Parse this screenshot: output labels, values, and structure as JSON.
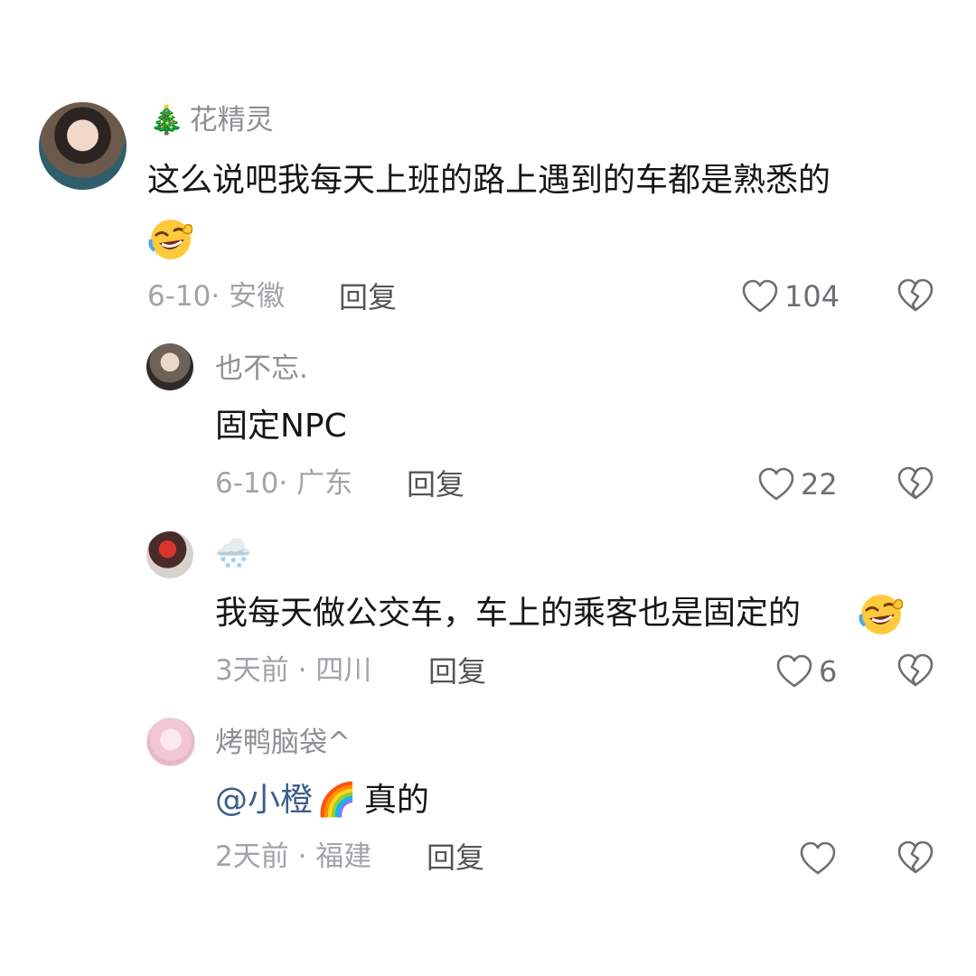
{
  "comments": [
    {
      "author": "花精灵",
      "author_prefix": "🎄",
      "text": "这么说吧我每天上班的路上遇到的车都是熟悉的",
      "emoji": "🤣",
      "meta": "6-10· 安徽",
      "reply_label": "回复",
      "likes": "104"
    }
  ],
  "replies": [
    {
      "author": "也不忘.",
      "text": "固定NPC",
      "meta": "6-10· 广东",
      "reply_label": "回复",
      "likes": "22"
    },
    {
      "author_icon": "🌨️",
      "text": "我每天做公交车，车上的乘客也是固定的",
      "emoji": "🤣",
      "meta": "3天前 · 四川",
      "reply_label": "回复",
      "likes": "6"
    },
    {
      "author": "烤鸭脑袋^",
      "mention": "@小橙",
      "mention_emoji": "🌈",
      "text": "真的",
      "meta": "2天前 · 福建",
      "reply_label": "回复",
      "likes": ""
    }
  ],
  "icons": {
    "like": "heart-outline-icon",
    "dislike": "broken-heart-icon"
  },
  "colors": {
    "mention": "#3c5d8a",
    "meta": "#a2a2a7",
    "name": "#8e8e93"
  }
}
